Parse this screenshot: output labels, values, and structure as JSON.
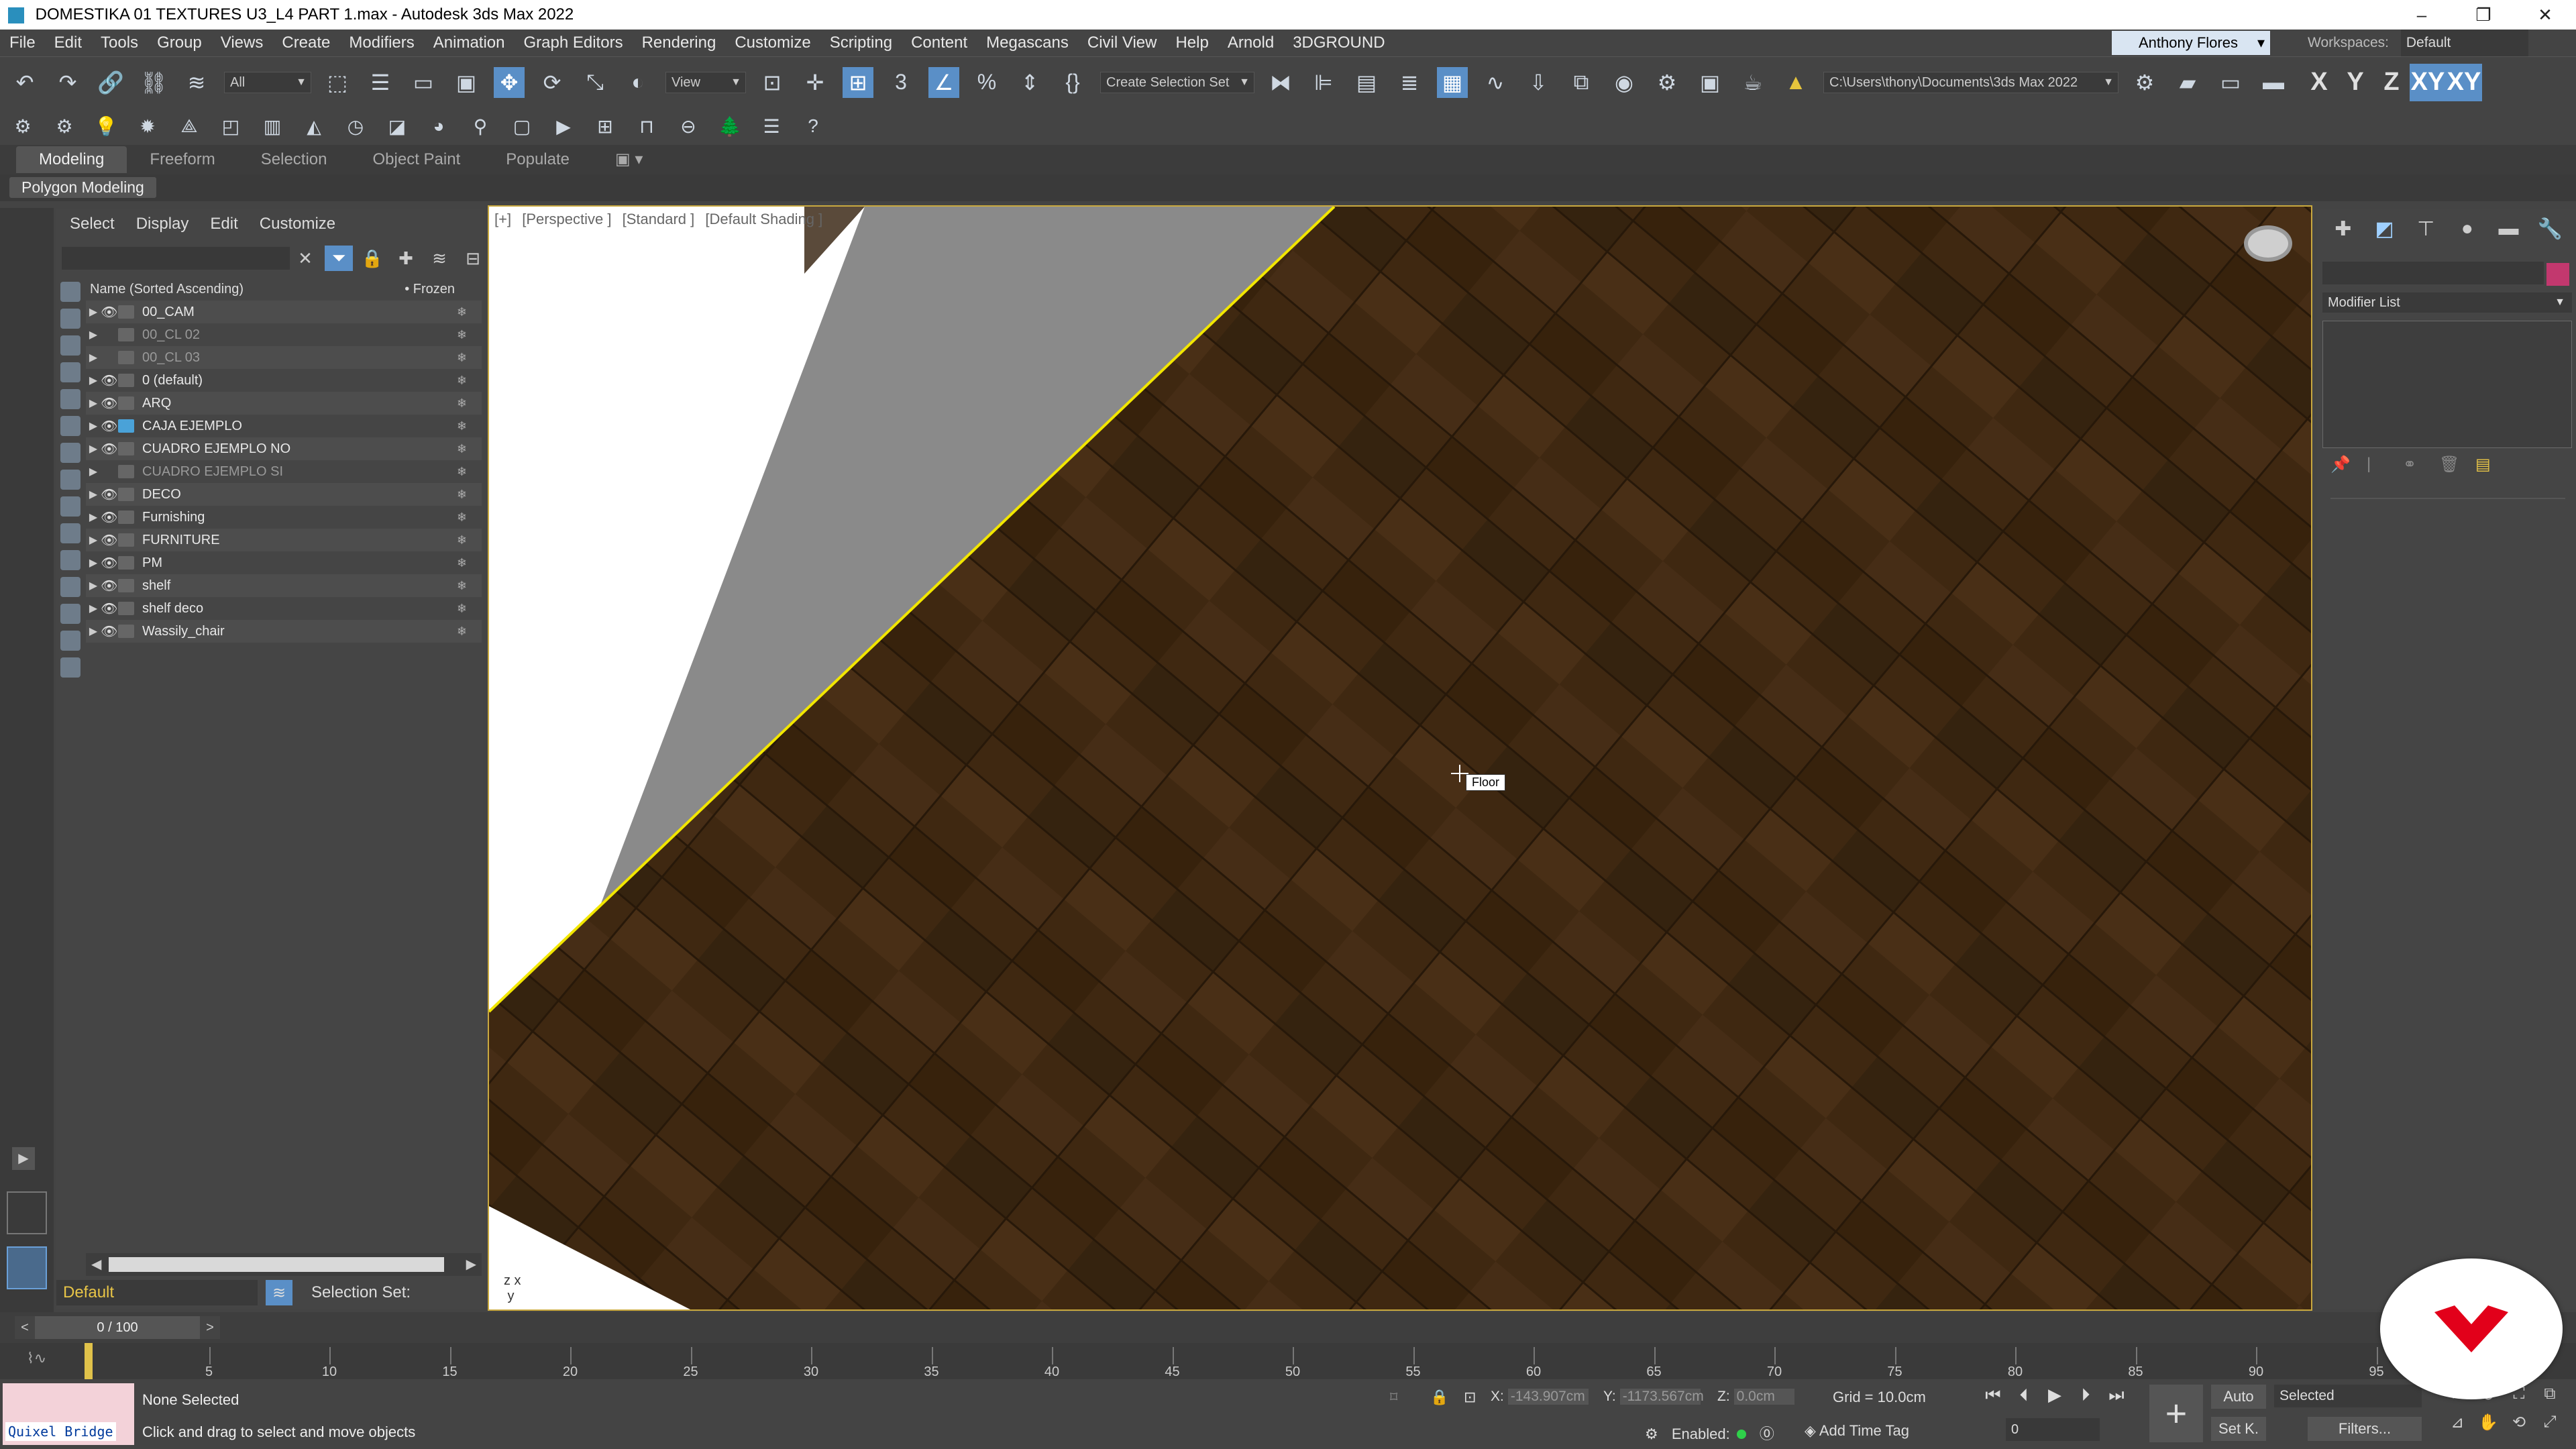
{
  "window": {
    "title": "DOMESTIKA 01 TEXTURES U3_L4 PART 1.max - Autodesk 3ds Max 2022",
    "controls": [
      "–",
      "❐",
      "✕"
    ]
  },
  "menu": [
    "File",
    "Edit",
    "Tools",
    "Group",
    "Views",
    "Create",
    "Modifiers",
    "Animation",
    "Graph Editors",
    "Rendering",
    "Customize",
    "Scripting",
    "Content",
    "Megascans",
    "Civil View",
    "Help",
    "Arnold",
    "3DGROUND"
  ],
  "user": {
    "name": "Anthony Flores"
  },
  "workspaces": {
    "label": "Workspaces:",
    "value": "Default"
  },
  "toolbar": {
    "filter_value": "All",
    "refcoord_value": "View",
    "selection_set_value": "Create Selection Set",
    "project_path": "C:\\Users\\thony\\Documents\\3ds Max 2022",
    "axis_x": "X",
    "axis_y": "Y",
    "axis_z": "Z",
    "axis_xy": "XY",
    "axis_xy2": "XY"
  },
  "ribbon": {
    "tabs": [
      "Modeling",
      "Freeform",
      "Selection",
      "Object Paint",
      "Populate"
    ],
    "active_tab": "Modeling",
    "panel_label": "Polygon Modeling"
  },
  "explorer": {
    "menu": [
      "Select",
      "Display",
      "Edit",
      "Customize"
    ],
    "header_name": "Name (Sorted Ascending)",
    "header_frozen": "• Frozen",
    "layers": [
      {
        "name": "00_CAM",
        "dim": false
      },
      {
        "name": "00_CL 02",
        "dim": true
      },
      {
        "name": "00_CL 03",
        "dim": true
      },
      {
        "name": "0 (default)",
        "dim": false
      },
      {
        "name": "ARQ",
        "dim": false
      },
      {
        "name": "CAJA EJEMPLO",
        "dim": false,
        "active": true
      },
      {
        "name": "CUADRO EJEMPLO NO",
        "dim": false
      },
      {
        "name": "CUADRO EJEMPLO SI",
        "dim": true
      },
      {
        "name": "DECO",
        "dim": false
      },
      {
        "name": "Furnishing",
        "dim": false
      },
      {
        "name": "FURNITURE",
        "dim": false
      },
      {
        "name": "PM",
        "dim": false
      },
      {
        "name": "shelf",
        "dim": false
      },
      {
        "name": "shelf deco",
        "dim": false
      },
      {
        "name": "Wassily_chair",
        "dim": false
      }
    ],
    "footer_layer": "Default",
    "selection_set_label": "Selection Set:"
  },
  "viewport": {
    "labels": [
      "[+]",
      "[Perspective ]",
      "[Standard ]",
      "[Default Shading ]"
    ],
    "tooltip": "Floor",
    "colors": {
      "floor": "#4a2f14",
      "wall": "#8a8a8a",
      "edge": "#f2e600"
    }
  },
  "command_panel": {
    "modifier_list": "Modifier List",
    "object_color": "#c2386e"
  },
  "timeline": {
    "frame_display": "0 / 100",
    "ticks": [
      5,
      10,
      15,
      20,
      25,
      30,
      35,
      40,
      45,
      50,
      55,
      60,
      65,
      70,
      75,
      80,
      85,
      90,
      95
    ]
  },
  "status": {
    "quixel": "Quixel Bridge",
    "selection": "None Selected",
    "prompt": "Click and drag to select and move objects",
    "x_label": "X:",
    "x_value": "-143.907cm",
    "y_label": "Y:",
    "y_value": "-1173.567cm",
    "z_label": "Z:",
    "z_value": "0.0cm",
    "grid": "Grid = 10.0cm",
    "enabled": "Enabled:",
    "add_time_tag": "Add Time Tag",
    "frame_value": "0",
    "auto": "Auto",
    "setk": "Set K.",
    "selected_dd": "Selected",
    "filters": "Filters..."
  }
}
